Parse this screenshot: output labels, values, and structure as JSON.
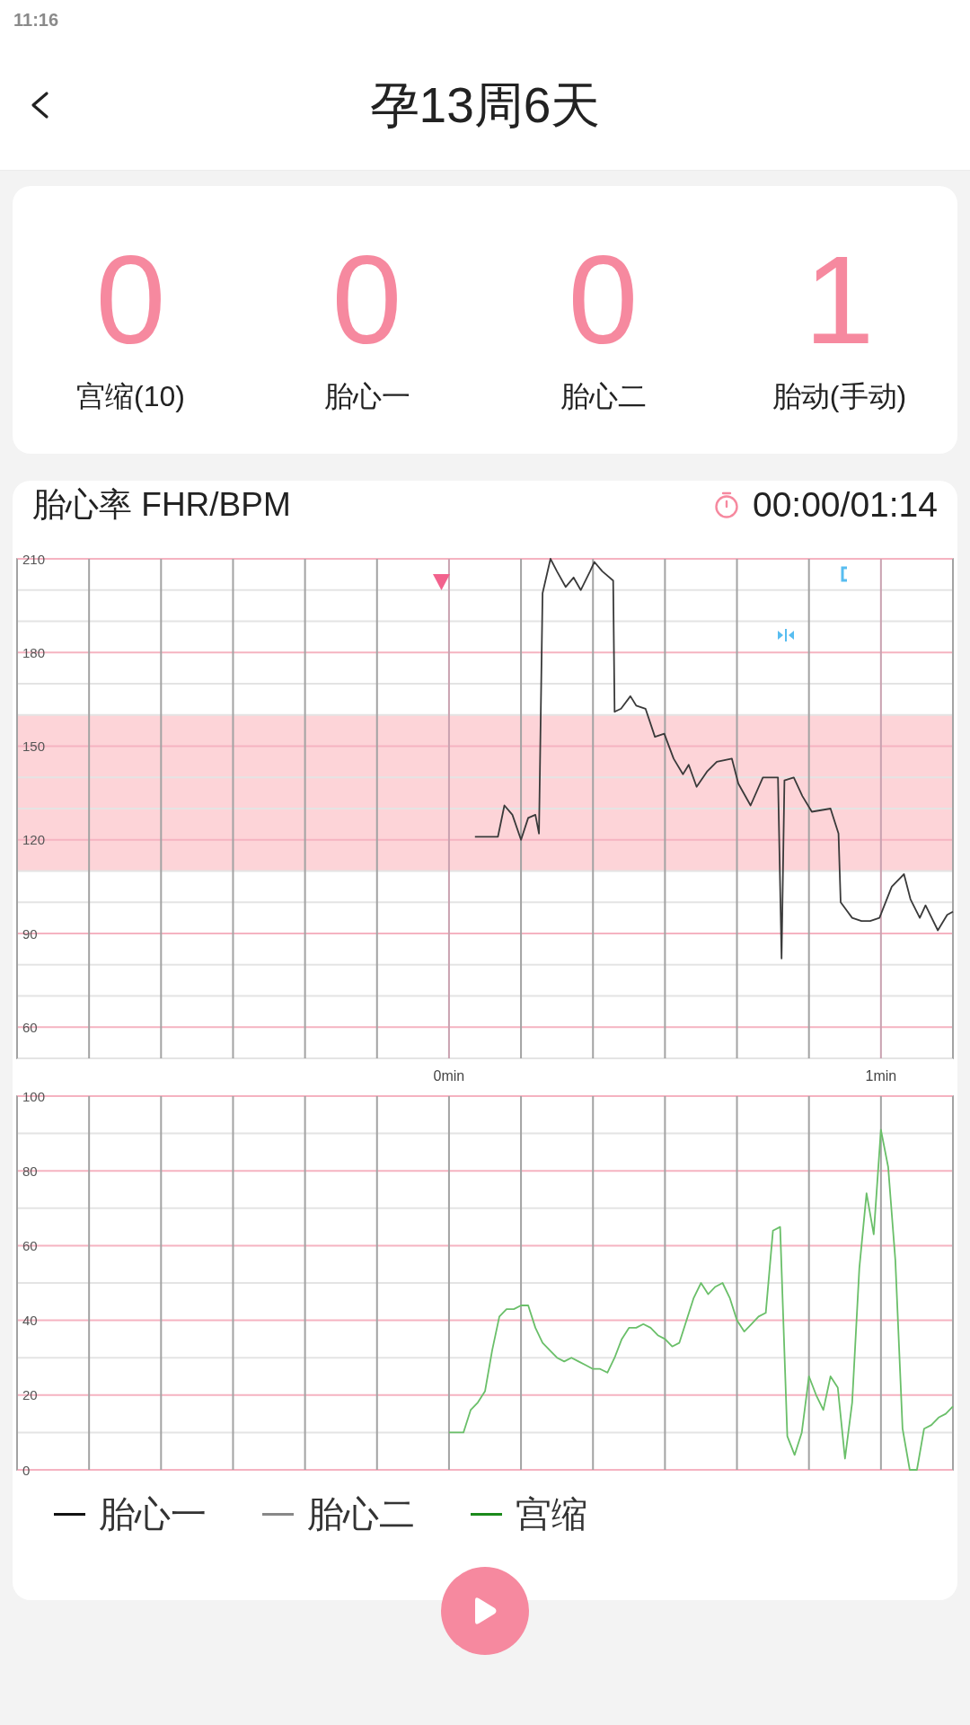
{
  "status_bar": {
    "time": "11:16"
  },
  "header": {
    "title": "孕13周6天"
  },
  "stats": [
    {
      "value": "0",
      "label": "宫缩(10)"
    },
    {
      "value": "0",
      "label": "胎心一"
    },
    {
      "value": "0",
      "label": "胎心二"
    },
    {
      "value": "1",
      "label": "胎动(手动)"
    }
  ],
  "monitor": {
    "title": "胎心率 FHR/BPM",
    "timer": "00:00/01:14",
    "fhr_chart": {
      "chart_data": {
        "type": "line",
        "x": [
          0.06,
          0.1133,
          0.1283,
          0.1467,
          0.1667,
          0.1833,
          0.2,
          0.2083,
          0.2167,
          0.235,
          0.25,
          0.27,
          0.2883,
          0.305,
          0.3267,
          0.3367,
          0.355,
          0.38,
          0.3833,
          0.3983,
          0.42,
          0.4333,
          0.455,
          0.4767,
          0.4983,
          0.52,
          0.5417,
          0.555,
          0.5733,
          0.5983,
          0.62,
          0.655,
          0.67,
          0.6983,
          0.7267,
          0.7617,
          0.77,
          0.7767,
          0.7983,
          0.8183,
          0.84,
          0.8833,
          0.9017,
          0.9067,
          0.9333,
          0.955,
          0.975,
          0.9967,
          1.025,
          1.0533,
          1.0683,
          1.09,
          1.1033,
          1.1317,
          1.1533,
          1.1667
        ],
        "series": [
          {
            "color": "#3a3a3a",
            "values": [
              121,
              121,
              131,
              128,
              120,
              127,
              128,
              122,
              199,
              210,
              206,
              201,
              204,
              200,
              206,
              209,
              206,
              203,
              161,
              162,
              166,
              163,
              162,
              153,
              154,
              146,
              141,
              144,
              137,
              142,
              145,
              146,
              138,
              131,
              140,
              140,
              82,
              139,
              140,
              134,
              129,
              130,
              122,
              100,
              95,
              94,
              94,
              95,
              105,
              109,
              101,
              95,
              99,
              91,
              96,
              97
            ]
          }
        ],
        "xlim": [
          -1,
          1.1667
        ],
        "ylim": [
          50,
          210
        ],
        "xticks": [
          {
            "value": 0,
            "label": "0min"
          },
          {
            "value": 1,
            "label": "1min"
          }
        ],
        "yticks": [
          60,
          90,
          120,
          150,
          180,
          210
        ],
        "grid": true,
        "bands": [
          {
            "axis": "y",
            "from": 110,
            "to": 160
          }
        ]
      }
    },
    "contraction_chart": {
      "chart_data": {
        "type": "line",
        "categories": [
          null,
          null,
          null,
          null,
          null,
          null,
          null,
          null,
          null,
          null,
          null,
          null,
          null,
          null,
          null,
          null,
          null,
          null,
          null,
          null,
          null,
          null,
          null,
          null,
          null,
          null,
          null,
          null,
          null,
          null,
          null,
          null,
          null,
          null,
          null,
          null,
          null,
          null,
          null,
          null,
          null,
          null,
          null,
          null,
          null,
          null,
          null,
          null,
          null,
          null,
          null,
          null,
          null,
          null,
          null,
          null,
          null,
          null,
          null,
          null,
          null,
          null,
          null,
          null,
          null,
          null,
          null,
          null,
          null,
          null,
          null,
          null,
          null,
          null,
          null,
          null,
          null,
          null,
          null,
          null,
          null,
          null,
          null,
          null,
          null,
          null,
          null,
          null,
          null,
          null,
          null,
          null,
          null,
          null,
          null,
          null,
          null,
          null,
          null,
          null,
          null,
          null,
          null,
          null,
          null,
          null,
          null,
          null,
          null,
          null,
          null,
          null,
          null,
          null,
          null,
          null,
          null,
          null,
          null,
          null,
          null,
          null,
          null,
          null,
          null,
          null,
          null,
          null,
          null,
          null,
          null
        ],
        "series": [
          {
            "color": "#6abf69",
            "values": [
              null,
              null,
              null,
              null,
              null,
              null,
              null,
              null,
              null,
              null,
              null,
              null,
              null,
              null,
              null,
              null,
              null,
              null,
              null,
              null,
              null,
              null,
              null,
              null,
              null,
              null,
              null,
              null,
              null,
              null,
              null,
              null,
              null,
              null,
              null,
              null,
              null,
              null,
              null,
              null,
              null,
              null,
              null,
              null,
              null,
              null,
              null,
              null,
              null,
              null,
              null,
              null,
              null,
              null,
              null,
              null,
              null,
              null,
              null,
              null,
              10,
              10,
              10,
              16,
              18,
              21,
              32,
              41,
              43,
              43,
              44,
              44,
              38,
              34,
              32,
              30,
              29,
              30,
              29,
              28,
              27,
              27,
              26,
              30,
              35,
              38,
              38,
              39,
              38,
              36,
              35,
              33,
              34,
              40,
              46,
              50,
              47,
              49,
              50,
              46,
              40,
              37,
              39,
              41,
              42,
              64,
              65,
              9,
              4,
              10,
              25,
              20,
              16,
              25,
              22,
              3,
              18,
              54,
              74,
              63,
              91,
              81,
              56,
              11,
              0,
              0,
              11,
              12,
              14,
              15,
              17
            ]
          }
        ],
        "ylim": [
          0,
          100
        ],
        "yticks": [
          0,
          20,
          40,
          60,
          80,
          100
        ],
        "grid": true
      }
    },
    "legend": [
      {
        "label": "胎心一",
        "color": "#111111"
      },
      {
        "label": "胎心二",
        "color": "#888888"
      },
      {
        "label": "宫缩",
        "color": "#1b8a1b"
      }
    ]
  }
}
